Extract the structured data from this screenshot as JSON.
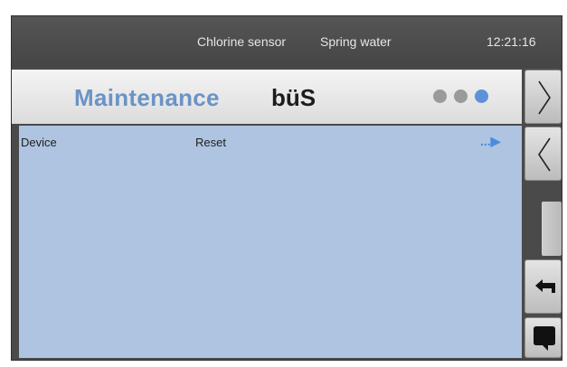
{
  "status": {
    "sensor": "Chlorine sensor",
    "water": "Spring water",
    "time": "12:21:16"
  },
  "title": {
    "main": "Maintenance",
    "brand": "büS",
    "page_dots": {
      "count": 3,
      "active_index": 2
    }
  },
  "list": {
    "rows": [
      {
        "label": "Device",
        "value": "Reset",
        "more": "...▶"
      }
    ]
  },
  "side": {
    "buttons": [
      {
        "name": "next-page",
        "icon": "chevron-right-icon"
      },
      {
        "name": "previous-page",
        "icon": "chevron-left-icon"
      },
      {
        "name": "back",
        "icon": "return-arrow-icon"
      },
      {
        "name": "message",
        "icon": "speech-bubble-icon"
      }
    ]
  },
  "colors": {
    "title_accent": "#6b93c6",
    "list_background": "#aec4e0",
    "active_dot": "#5d92d8",
    "inactive_dot": "#9a9a9a",
    "status_bar": "#4a4a4a"
  }
}
